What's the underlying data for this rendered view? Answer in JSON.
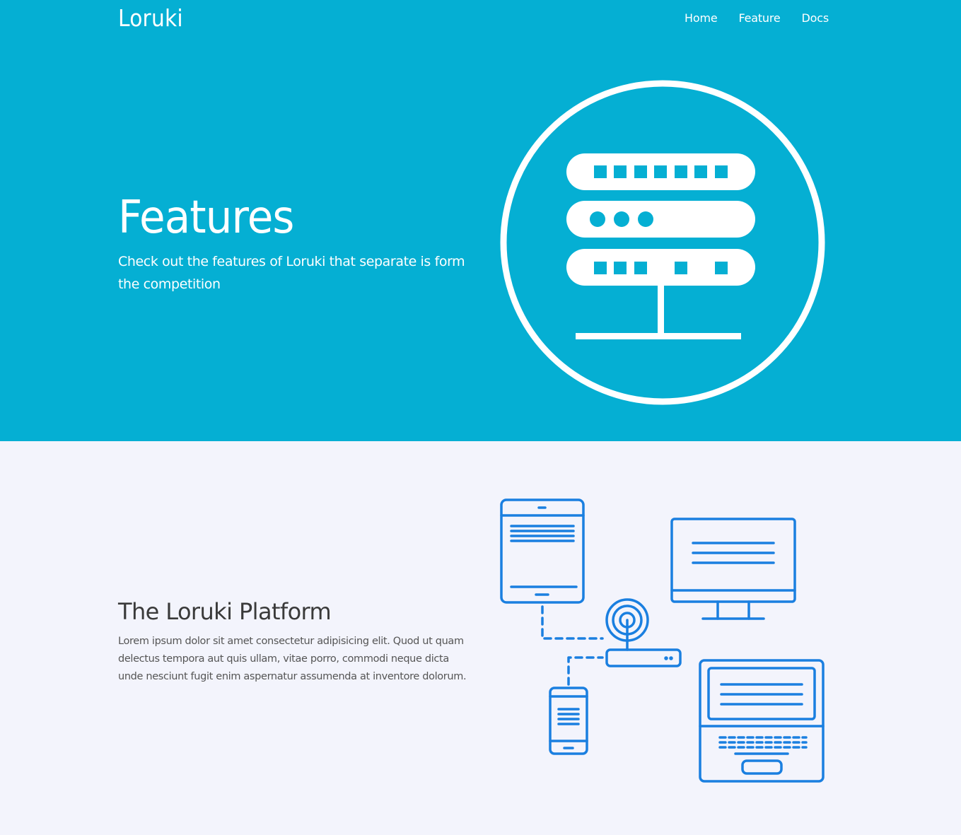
{
  "colors": {
    "hero_bg": "#05afd3",
    "platform_bg": "#f3f4fc",
    "accent_blue": "#1a7fe0"
  },
  "nav": {
    "logo": "Loruki",
    "links": [
      {
        "label": "Home"
      },
      {
        "label": "Feature"
      },
      {
        "label": "Docs"
      }
    ]
  },
  "hero": {
    "title": "Features",
    "subtitle": "Check out the features of Loruki that separate is form the competition",
    "illustration_icon": "server-rack-icon"
  },
  "platform": {
    "title": "The Loruki Platform",
    "text": "Lorem ipsum dolor sit amet consectetur adipisicing elit. Quod ut quam delectus tempora aut quis ullam, vitae porro, commodi neque dicta unde nesciunt fugit enim aspernatur assumenda at inventore dolorum.",
    "illustration_icon": "connected-devices-icon"
  }
}
